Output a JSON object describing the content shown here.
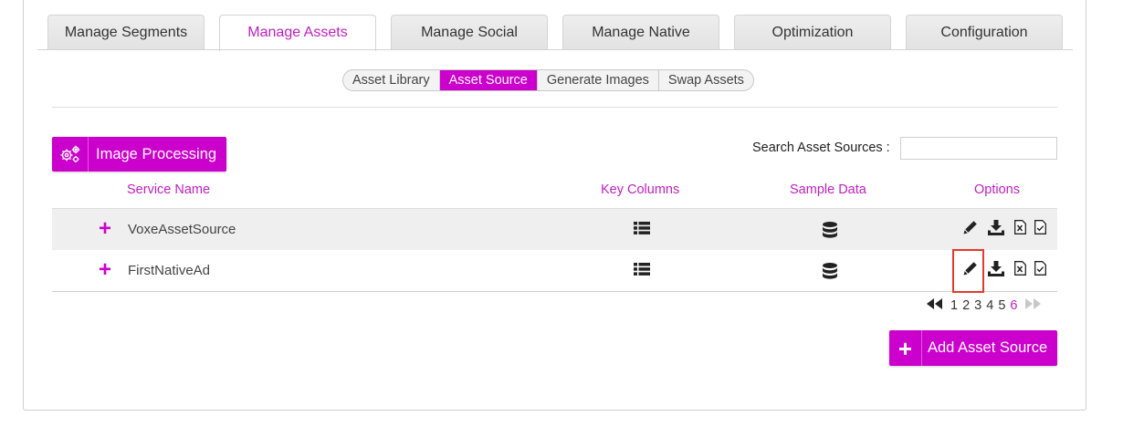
{
  "tabs": [
    {
      "label": "Manage Segments"
    },
    {
      "label": "Manage Assets"
    },
    {
      "label": "Manage Social"
    },
    {
      "label": "Manage Native"
    },
    {
      "label": "Optimization"
    },
    {
      "label": "Configuration"
    }
  ],
  "subnav": [
    {
      "label": "Asset Library"
    },
    {
      "label": "Asset Source"
    },
    {
      "label": "Generate Images"
    },
    {
      "label": "Swap Assets"
    }
  ],
  "toolbar": {
    "image_processing_label": "Image Processing",
    "search_label": "Search Asset Sources :",
    "search_value": ""
  },
  "table": {
    "headers": {
      "service_name": "Service Name",
      "key_columns": "Key Columns",
      "sample_data": "Sample Data",
      "options": "Options"
    },
    "rows": [
      {
        "service_name": "VoxeAssetSource"
      },
      {
        "service_name": "FirstNativeAd"
      }
    ]
  },
  "pagination": {
    "pages": [
      "1",
      "2",
      "3",
      "4",
      "5",
      "6"
    ],
    "current": "6"
  },
  "actions": {
    "add_label": "Add Asset Source"
  },
  "colors": {
    "accent": "#cc00cc",
    "highlight_box": "#e53a2a"
  },
  "icons": {
    "image_processing": "gears-icon",
    "key_columns": "list-icon",
    "sample_data": "database-icon",
    "edit": "pencil-icon",
    "download": "download-icon",
    "excel": "excel-file-icon",
    "validate": "check-file-icon"
  }
}
